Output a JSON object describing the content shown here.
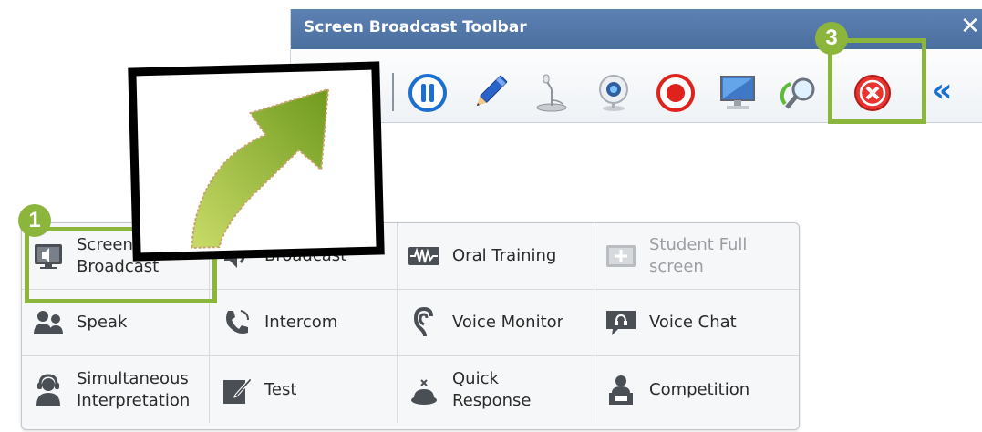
{
  "toolbar": {
    "title": "Screen Broadcast Toolbar",
    "close_glyph": "✕",
    "buttons": [
      {
        "name": "pause",
        "icon": "pause-icon"
      },
      {
        "name": "pen",
        "icon": "pencil-icon"
      },
      {
        "name": "microphone",
        "icon": "microphone-icon"
      },
      {
        "name": "camera",
        "icon": "webcam-icon"
      },
      {
        "name": "record",
        "icon": "record-icon"
      },
      {
        "name": "monitor",
        "icon": "monitor-icon"
      },
      {
        "name": "zoom",
        "icon": "magnifier-icon"
      },
      {
        "name": "stop",
        "icon": "stop-x-icon"
      },
      {
        "name": "collapse",
        "icon": "double-chevron-left-icon"
      }
    ],
    "collapse_glyph": "«"
  },
  "callouts": {
    "one": "1",
    "three": "3"
  },
  "colors": {
    "accent": "#8cb53c",
    "title_bar": "#4f74a6",
    "stop_red": "#e8332f"
  },
  "panel": {
    "rows": [
      [
        {
          "label": "Screen\nBroadcast",
          "icon": "screen-broadcast-icon",
          "disabled": false
        },
        {
          "label": "Broadcast",
          "icon": "voice-broadcast-icon",
          "disabled": false
        },
        {
          "label": "Oral Training",
          "icon": "waveform-icon",
          "disabled": false
        },
        {
          "label": "Student Full\nscreen",
          "icon": "fullscreen-icon",
          "disabled": true
        }
      ],
      [
        {
          "label": "Speak",
          "icon": "speak-icon",
          "disabled": false
        },
        {
          "label": "Intercom",
          "icon": "phone-icon",
          "disabled": false
        },
        {
          "label": "Voice Monitor",
          "icon": "ear-icon",
          "disabled": false
        },
        {
          "label": "Voice Chat",
          "icon": "chat-icon",
          "disabled": false
        }
      ],
      [
        {
          "label": "Simultaneous\nInterpretation",
          "icon": "interpreter-icon",
          "disabled": false
        },
        {
          "label": "Test",
          "icon": "test-icon",
          "disabled": false
        },
        {
          "label": "Quick\nResponse",
          "icon": "buzzer-icon",
          "disabled": false
        },
        {
          "label": "Competition",
          "icon": "competition-icon",
          "disabled": false
        }
      ]
    ]
  }
}
